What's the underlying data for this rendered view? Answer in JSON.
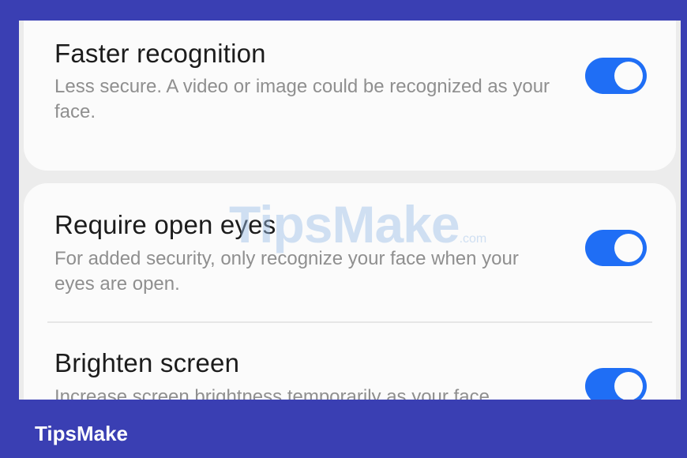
{
  "settings": [
    {
      "title": "Faster recognition",
      "description": "Less secure. A video or image could be recognized as your face.",
      "enabled": true
    },
    {
      "title": "Require open eyes",
      "description": "For added security, only recognize your face when your eyes are open.",
      "enabled": true
    },
    {
      "title": "Brighten screen",
      "description": "Increase screen brightness temporarily as your face",
      "enabled": true
    }
  ],
  "watermark": {
    "text": "TipsMake",
    "suffix": ".com"
  },
  "footer": {
    "logo_text": "TipsMake"
  },
  "colors": {
    "toggle_on": "#1f6ef5",
    "frame": "#3a3fb3"
  }
}
